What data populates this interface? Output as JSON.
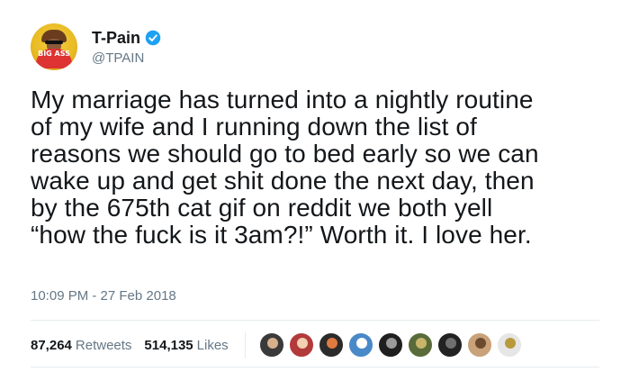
{
  "tweet": {
    "display_name": "T-Pain",
    "handle": "@TPAIN",
    "verified_icon": "verified-badge-icon",
    "avatar_text": "BIG ASS",
    "text_lines": [
      "My marriage has turned into a nightly routine",
      "of my wife and I running down the list of",
      "reasons we should go to bed early so we can",
      "wake up and get shit done the next day, then",
      "by the 675th cat gif on reddit we both yell",
      "“how the fuck is it 3am?!” Worth it. I love her."
    ],
    "timestamp": "10:09 PM - 27 Feb 2018"
  },
  "stats": {
    "retweets_count": "87,264",
    "retweets_label": "Retweets",
    "likes_count": "514,135",
    "likes_label": "Likes"
  },
  "likers": [
    {
      "icon": "avatar-icon",
      "color": "#3a3a3a",
      "accent": "#d9b08c"
    },
    {
      "icon": "avatar-icon",
      "color": "#b33a3a",
      "accent": "#f2d0b0"
    },
    {
      "icon": "avatar-icon",
      "color": "#2b2b2b",
      "accent": "#e07a3f"
    },
    {
      "icon": "avatar-icon",
      "color": "#4a89c8",
      "accent": "#ffffff"
    },
    {
      "icon": "avatar-icon",
      "color": "#1f1f1f",
      "accent": "#9a9a9a"
    },
    {
      "icon": "avatar-icon",
      "color": "#5a6b3a",
      "accent": "#c9b56a"
    },
    {
      "icon": "avatar-icon",
      "color": "#222222",
      "accent": "#6f6f6f"
    },
    {
      "icon": "avatar-icon",
      "color": "#c9a27a",
      "accent": "#6b4a2f"
    },
    {
      "icon": "avatar-icon",
      "color": "#e6e6e6",
      "accent": "#b89a3c"
    }
  ],
  "colors": {
    "text": "#14171a",
    "secondary": "#657786",
    "verified_blue": "#1da1f2",
    "divider": "#e6ecf0"
  }
}
